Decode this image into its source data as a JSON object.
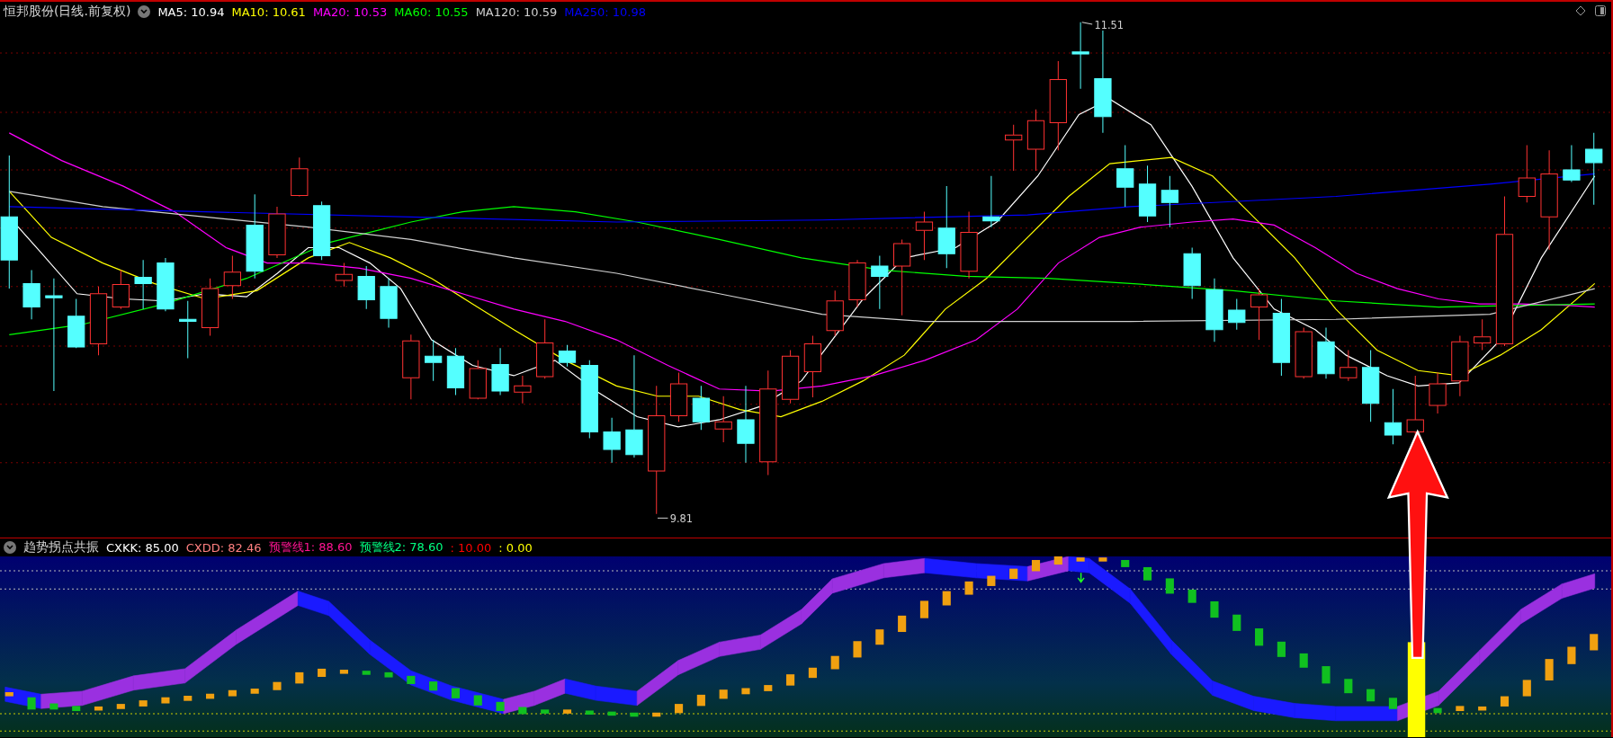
{
  "chart": {
    "title": "恒邦股份(日线.前复权)",
    "legend": [
      {
        "label": "MA5: 10.94",
        "color": "#ffffff"
      },
      {
        "label": "MA10: 10.61",
        "color": "#ffff00"
      },
      {
        "label": "MA20: 10.53",
        "color": "#ff00ff"
      },
      {
        "label": "MA60: 10.55",
        "color": "#00ff00"
      },
      {
        "label": "MA120: 10.59",
        "color": "#d0d0d0"
      },
      {
        "label": "MA250: 10.98",
        "color": "#0000ff"
      }
    ],
    "high_label": "11.51",
    "low_label": "9.81"
  },
  "indicator": {
    "title": "趋势拐点共振",
    "legend": [
      {
        "label": "CXKK: 85.00",
        "color": "#ffffff"
      },
      {
        "label": "CXDD: 82.46",
        "color": "#ff8080"
      },
      {
        "label": "预警线1: 88.60",
        "color": "#ff1493"
      },
      {
        "label": "预警线2: 78.60",
        "color": "#00ff80"
      },
      {
        "label": ": 10.00",
        "color": "#ff0000"
      },
      {
        "label": ": 0.00",
        "color": "#ffff00"
      }
    ]
  }
}
